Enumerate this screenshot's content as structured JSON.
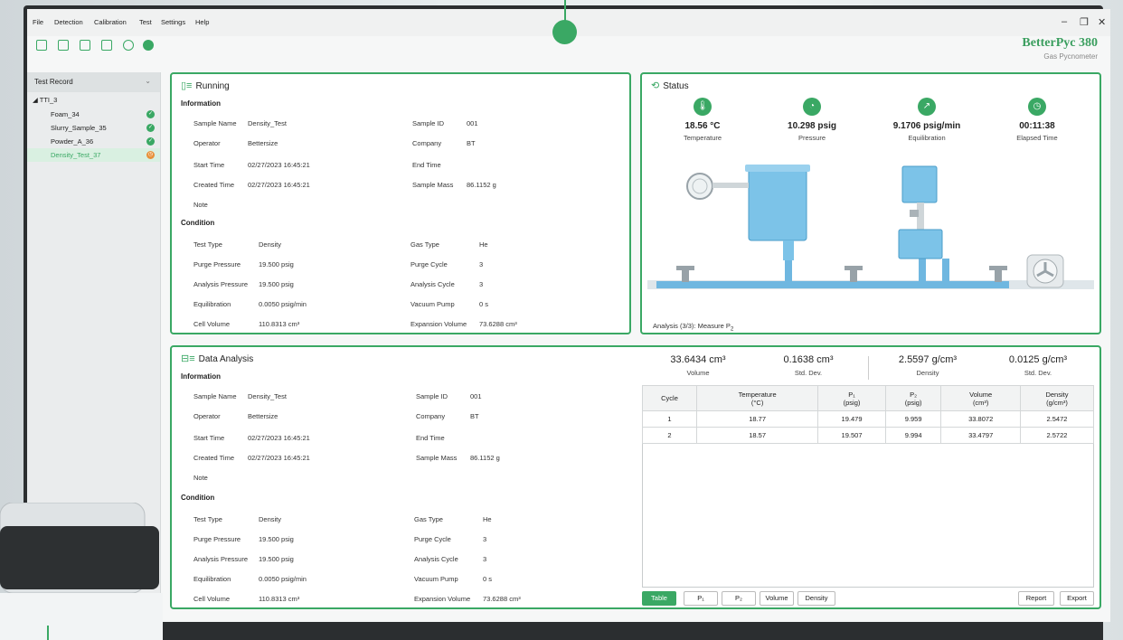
{
  "menu": [
    "File",
    "Detection",
    "Calibration",
    "Test",
    "Settings",
    "Help"
  ],
  "window_controls": {
    "minimize": "–",
    "restore": "❐",
    "close": "✕"
  },
  "brand": {
    "name": "BetterPyc 380",
    "subtitle": "Gas Pycnometer"
  },
  "sidebar": {
    "header": "Test Record",
    "root": "TTI_3",
    "items": [
      {
        "label": "Foam_34",
        "status": "done"
      },
      {
        "label": "Slurry_Sample_35",
        "status": "done"
      },
      {
        "label": "Powder_A_36",
        "status": "done"
      },
      {
        "label": "Density_Test_37",
        "status": "running"
      }
    ]
  },
  "running": {
    "title": "Running",
    "info_title": "Information",
    "condition_title": "Condition",
    "info_fields": [
      {
        "label": "Sample Name",
        "value": "Density_Test"
      },
      {
        "label": "Sample ID",
        "value": "001"
      },
      {
        "label": "Operator",
        "value": "Bettersize"
      },
      {
        "label": "Company",
        "value": "BT"
      },
      {
        "label": "Start Time",
        "value": "02/27/2023 16:45:21"
      },
      {
        "label": "End Time",
        "value": ""
      },
      {
        "label": "Created Time",
        "value": "02/27/2023 16:45:21"
      },
      {
        "label": "Sample Mass",
        "value": "86.1152 g"
      },
      {
        "label": "Note",
        "value": ""
      }
    ],
    "condition_fields": [
      {
        "label": "Test Type",
        "value": "Density"
      },
      {
        "label": "Gas Type",
        "value": "He"
      },
      {
        "label": "Purge Pressure",
        "value": "19.500 psig"
      },
      {
        "label": "Purge Cycle",
        "value": "3"
      },
      {
        "label": "Analysis Pressure",
        "value": "19.500 psig"
      },
      {
        "label": "Analysis Cycle",
        "value": "3"
      },
      {
        "label": "Equilibration",
        "value": "0.0050 psig/min"
      },
      {
        "label": "Vacuum Pump",
        "value": "0 s"
      },
      {
        "label": "Cell Volume",
        "value": "110.8313 cm³"
      },
      {
        "label": "Expansion Volume",
        "value": "73.6288 cm³"
      }
    ]
  },
  "status": {
    "title": "Status",
    "metrics": [
      {
        "icon": "thermometer-icon",
        "value": "18.56 °C",
        "label": "Temperature"
      },
      {
        "icon": "gauge-icon",
        "value": "10.298 psig",
        "label": "Pressure"
      },
      {
        "icon": "trend-icon",
        "value": "9.1706 psig/min",
        "label": "Equilibration"
      },
      {
        "icon": "timer-icon",
        "value": "00:11:38",
        "label": "Elapsed Time"
      }
    ],
    "phase_prefix": "Analysis (3/3): Measure P",
    "phase_sub": "2"
  },
  "analysis": {
    "title": "Data Analysis",
    "summary": [
      {
        "value": "33.6434 cm³",
        "label": "Volume"
      },
      {
        "value": "0.1638 cm³",
        "label": "Std. Dev."
      },
      {
        "value": "2.5597 g/cm³",
        "label": "Density"
      },
      {
        "value": "0.0125 g/cm³",
        "label": "Std. Dev."
      }
    ],
    "table": {
      "headers": [
        [
          "Cycle",
          ""
        ],
        [
          "Temperature",
          "(°C)"
        ],
        [
          "P₁",
          "(psig)"
        ],
        [
          "P₂",
          "(psig)"
        ],
        [
          "Volume",
          "(cm³)"
        ],
        [
          "Density",
          "(g/cm³)"
        ]
      ],
      "rows": [
        [
          "1",
          "18.77",
          "19.479",
          "9.959",
          "33.8072",
          "2.5472"
        ],
        [
          "2",
          "18.57",
          "19.507",
          "9.994",
          "33.4797",
          "2.5722"
        ]
      ]
    },
    "tabs": [
      "Table",
      "P₁",
      "P₂",
      "Volume",
      "Density"
    ],
    "actions": [
      "Report",
      "Export"
    ]
  },
  "colors": {
    "accent": "#3aa864",
    "running": "#e8913a"
  }
}
